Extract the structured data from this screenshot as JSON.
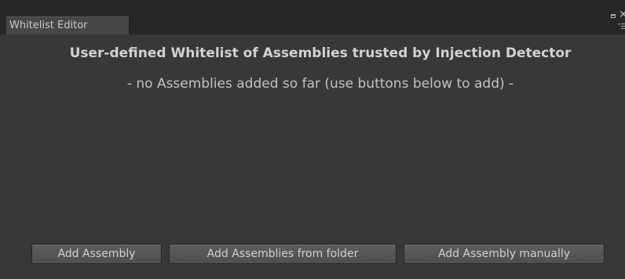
{
  "window": {
    "tab_title": "Whitelist Editor",
    "controls": {
      "maximize_icon": "maximize-icon",
      "close_icon": "close-icon",
      "menu_icon": "menu-icon",
      "close_glyph": "✕"
    }
  },
  "panel": {
    "title": "User-defined Whitelist of Assemblies trusted by Injection Detector",
    "empty_message": "- no Assemblies added so far (use buttons below to add) -"
  },
  "buttons": {
    "add_assembly": "Add Assembly",
    "add_from_folder": "Add Assemblies from folder",
    "add_manually": "Add Assembly manually"
  },
  "colors": {
    "background": "#383838",
    "tab_strip": "#272727",
    "tab": "#474747",
    "text": "#d2d2d2"
  }
}
